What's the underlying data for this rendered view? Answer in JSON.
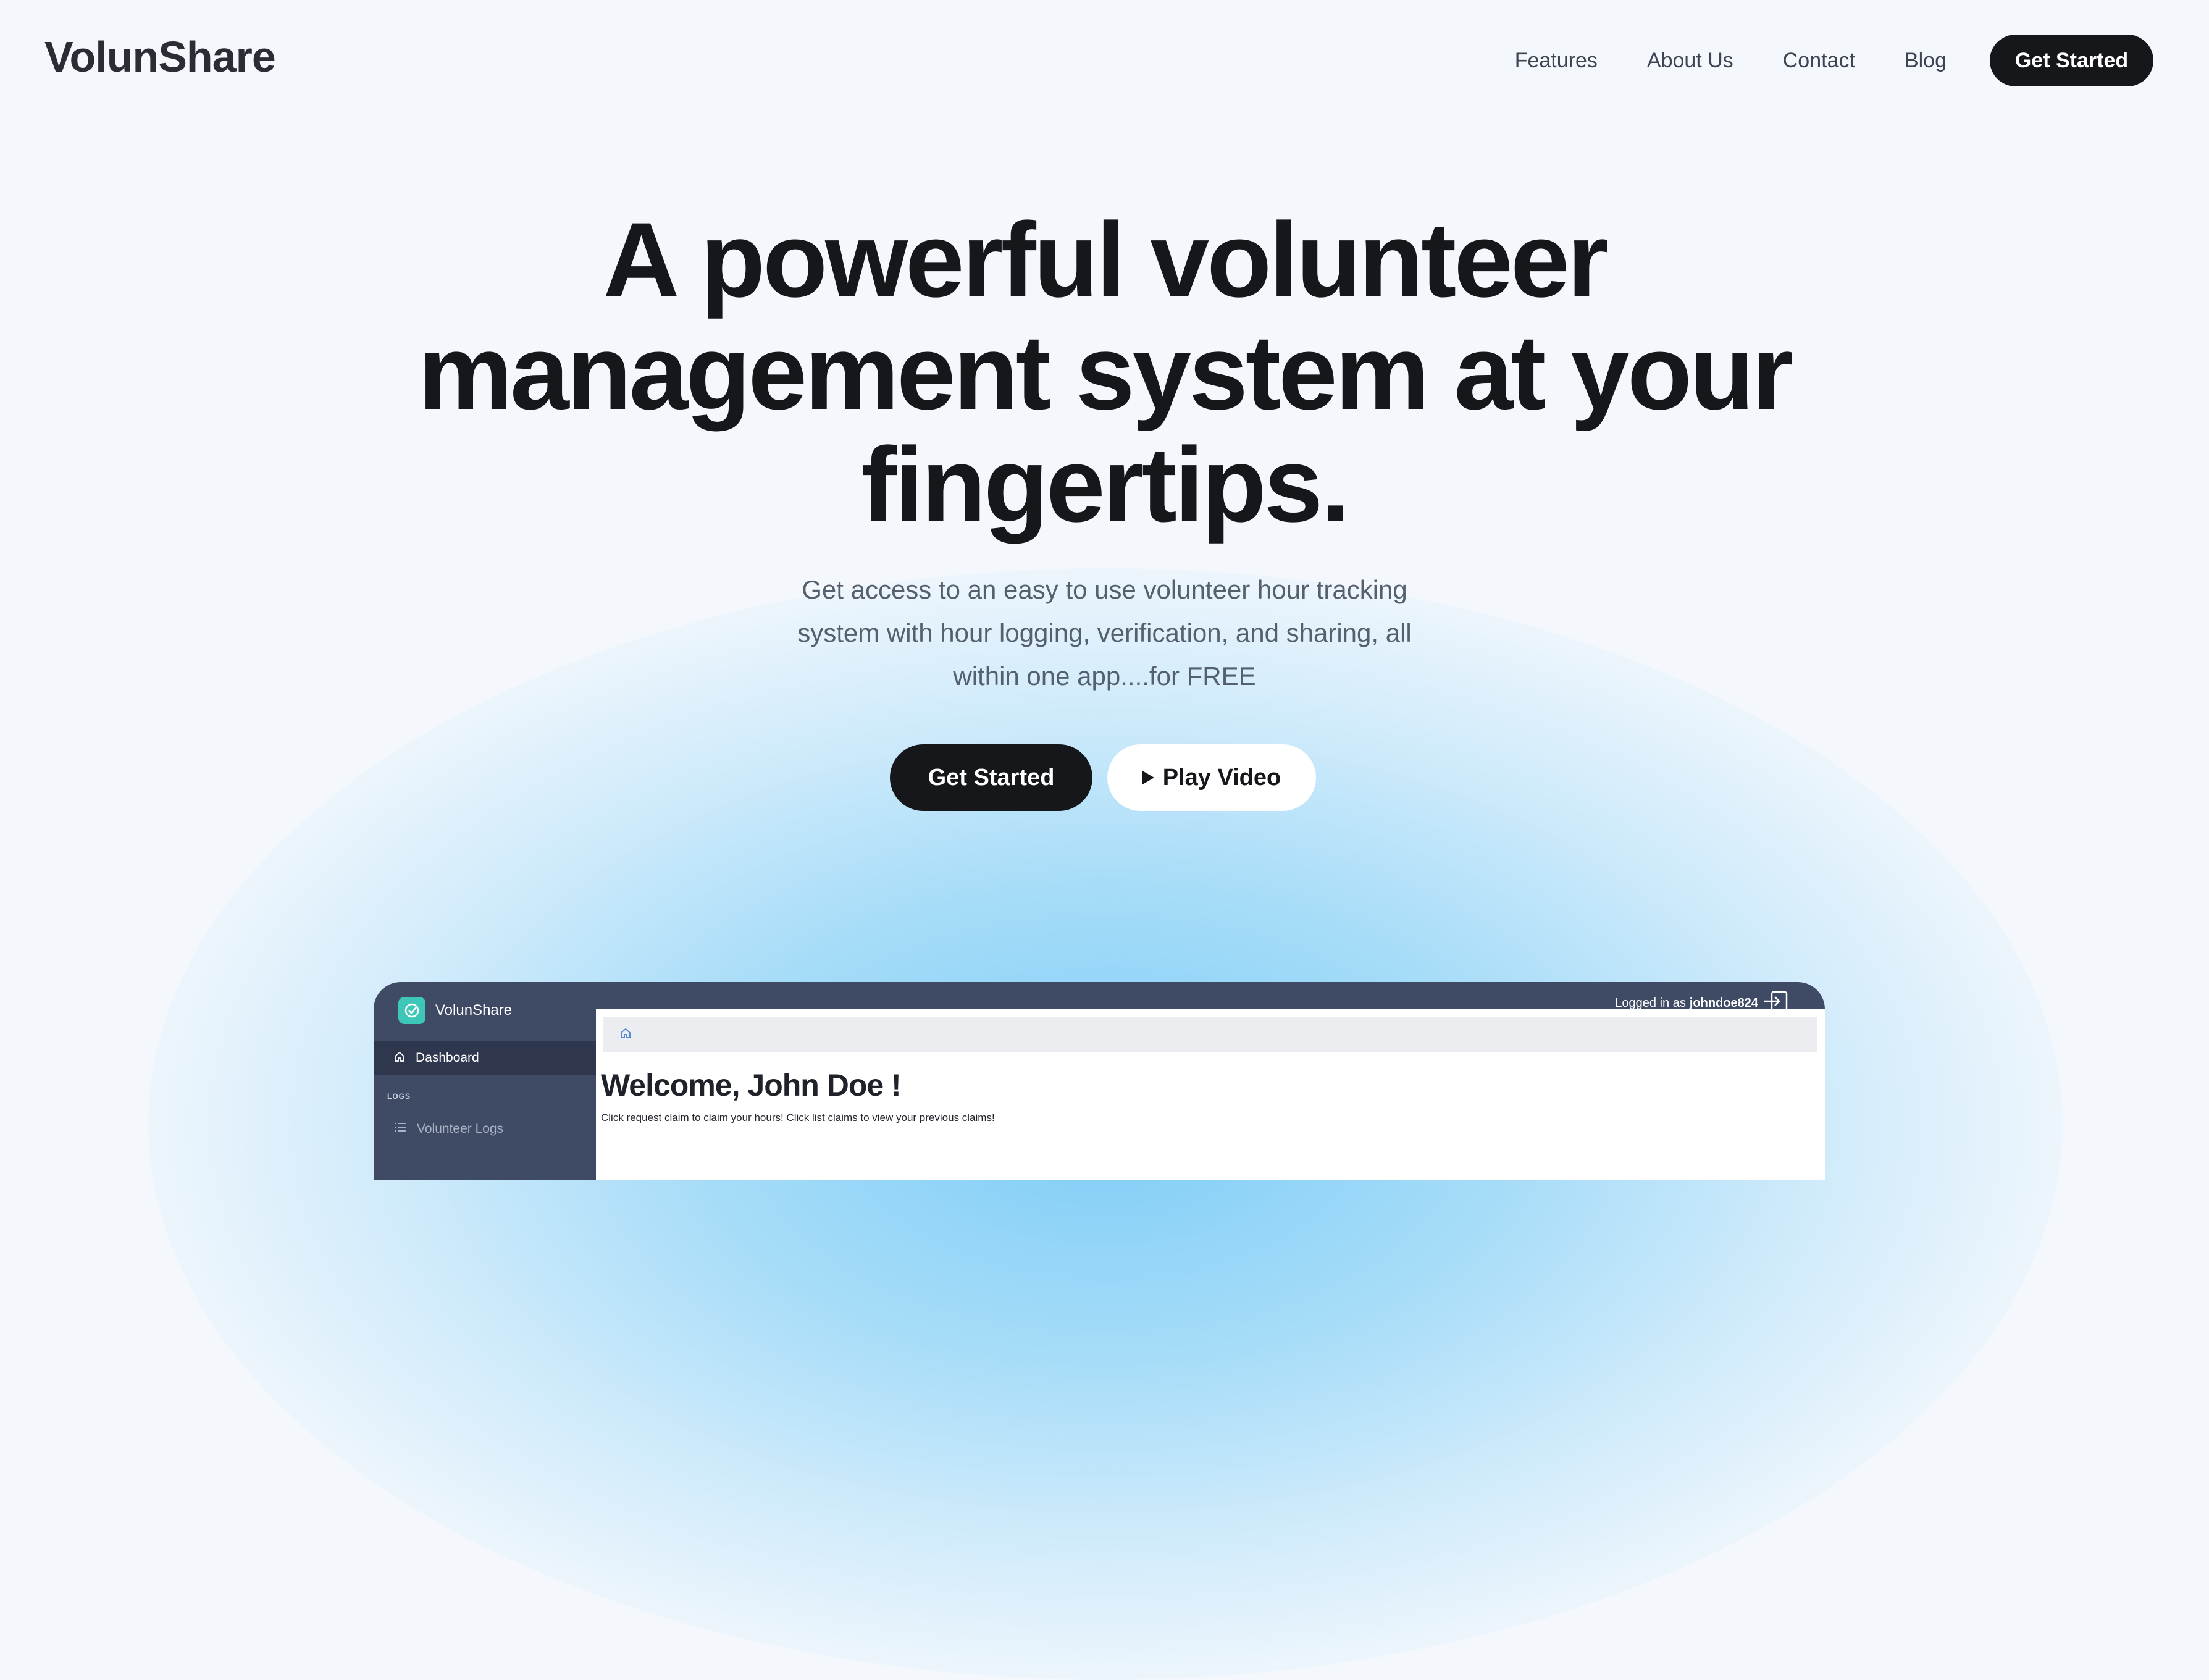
{
  "brand": "VolunShare",
  "nav": {
    "links": [
      "Features",
      "About Us",
      "Contact",
      "Blog"
    ],
    "cta": "Get Started"
  },
  "hero": {
    "title_lines": [
      "A powerful volunteer",
      "management system at your",
      "fingertips."
    ],
    "subtitle_lines": [
      "Get access to an easy to use volunteer hour tracking",
      "system with hour logging, verification, and sharing, all",
      "within one app....for FREE"
    ],
    "primary_button": "Get Started",
    "secondary_button": "Play Video"
  },
  "preview": {
    "sidebar": {
      "brand": "VolunShare",
      "active_item": "Dashboard",
      "section_label": "LOGS",
      "item": "Volunteer Logs"
    },
    "topbar": {
      "logged_in_prefix": "Logged in as",
      "username": "johndoe824"
    },
    "main": {
      "welcome": "Welcome, John Doe !",
      "instructions": "Click request claim to claim your hours! Click list claims to view your previous claims!"
    }
  },
  "colors": {
    "primary_dark": "#15171b",
    "sidebar": "#3f4a64",
    "glow": "#7fcdf7",
    "accent_teal": "#3ec7b8"
  },
  "icons": [
    "play-icon",
    "home-icon",
    "list-icon",
    "logout-icon",
    "check-logo-icon"
  ]
}
